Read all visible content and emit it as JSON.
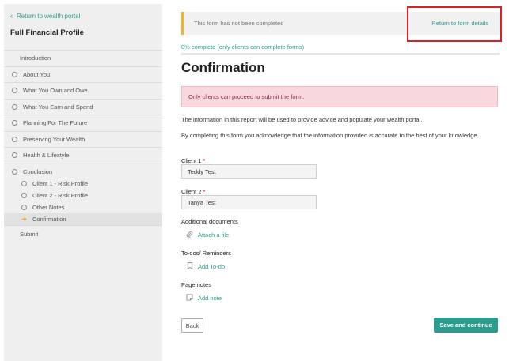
{
  "sidebar": {
    "back_link": "Return to wealth portal",
    "title": "Full Financial Profile",
    "items": [
      {
        "label": "Introduction"
      },
      {
        "label": "About You"
      },
      {
        "label": "What You Own and Owe"
      },
      {
        "label": "What You Earn and Spend"
      },
      {
        "label": "Planning For The Future"
      },
      {
        "label": "Preserving Your Wealth"
      },
      {
        "label": "Health & Lifestyle"
      }
    ],
    "conclusion": {
      "label": "Conclusion",
      "subitems": [
        {
          "label": "Client 1 - Risk Profile"
        },
        {
          "label": "Client 2 - Risk Profile"
        },
        {
          "label": "Other Notes"
        },
        {
          "label": "Confirmation"
        }
      ]
    },
    "submit": "Submit"
  },
  "banner": {
    "text": "This form has not been completed",
    "link": "Return to form details"
  },
  "progress": {
    "text": "0% complete (only clients can complete forms)",
    "value": 0
  },
  "page_title": "Confirmation",
  "alert": "Only clients can proceed to submit the form.",
  "paragraphs": {
    "p1": "The information in this report will be used to provide advice and populate your wealth portal.",
    "p2": "By completing this form you acknowledge that the information provided is accurate to the best of your knowledge."
  },
  "fields": {
    "client1_label": "Client 1",
    "client1_value": "Teddy Test",
    "client2_label": "Client 2",
    "client2_value": "Tanya Test",
    "required_mark": "*"
  },
  "sections": {
    "docs_label": "Additional documents",
    "docs_action": "Attach a file",
    "todos_label": "To-dos/ Reminders",
    "todos_action": "Add To-do",
    "notes_label": "Page notes",
    "notes_action": "Add note"
  },
  "buttons": {
    "back": "Back",
    "save": "Save and continue"
  },
  "icons": {
    "back": "chevron-left-icon",
    "step": "circle-icon",
    "current": "arrow-right-icon",
    "attach": "paperclip-icon",
    "todo": "bookmark-icon",
    "note": "note-icon"
  },
  "colors": {
    "accent": "#2a9d8f",
    "warning": "#f0b429",
    "alert_bg": "#f8d7de",
    "highlight": "#e02020"
  }
}
